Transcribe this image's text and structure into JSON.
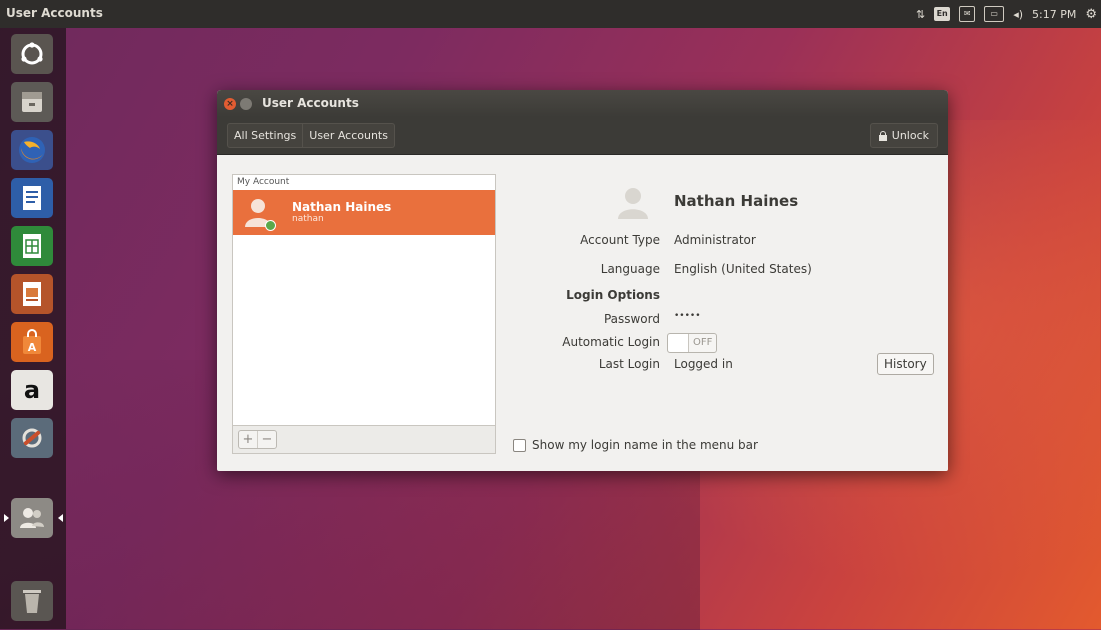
{
  "topbar": {
    "app_title": "User Accounts",
    "keyboard_layout": "En",
    "clock": "5:17 PM",
    "tray_icons": [
      "network-icon",
      "keyboard-layout-icon",
      "mail-icon",
      "battery-icon",
      "volume-icon",
      "gear-icon"
    ]
  },
  "launcher": {
    "items": [
      {
        "name": "dash-home",
        "icon": "ubuntu-logo-icon"
      },
      {
        "name": "files",
        "icon": "file-cabinet-icon"
      },
      {
        "name": "firefox",
        "icon": "firefox-icon"
      },
      {
        "name": "writer",
        "icon": "document-icon"
      },
      {
        "name": "calc",
        "icon": "spreadsheet-icon"
      },
      {
        "name": "impress",
        "icon": "presentation-icon"
      },
      {
        "name": "software-center",
        "icon": "shopping-bag-icon"
      },
      {
        "name": "amazon",
        "icon": "amazon-icon"
      },
      {
        "name": "system-settings",
        "icon": "tools-icon"
      },
      {
        "name": "user-accounts",
        "icon": "users-icon"
      },
      {
        "name": "trash",
        "icon": "trash-icon"
      }
    ],
    "amazon_letter": "a"
  },
  "window": {
    "title": "User Accounts",
    "breadcrumb": [
      "All Settings",
      "User Accounts"
    ],
    "unlock_label": "Unlock",
    "list_header": "My Account",
    "account": {
      "full_name": "Nathan Haines",
      "login": "nathan"
    },
    "add_label": "+",
    "remove_label": "−",
    "details": {
      "full_name": "Nathan Haines",
      "account_type_label": "Account Type",
      "account_type": "Administrator",
      "language_label": "Language",
      "language": "English (United States)",
      "login_options_label": "Login Options",
      "password_label": "Password",
      "password": "•••••",
      "auto_login_label": "Automatic Login",
      "auto_login_state": "OFF",
      "last_login_label": "Last Login",
      "last_login": "Logged in",
      "history_label": "History"
    },
    "show_login_name_label": "Show my login name in the menu bar",
    "show_login_name_checked": false
  },
  "colors": {
    "accent": "#e9703d",
    "panel": "#2f2d2b",
    "window_bg": "#f2f1ef",
    "status_online": "#5aa84b"
  }
}
